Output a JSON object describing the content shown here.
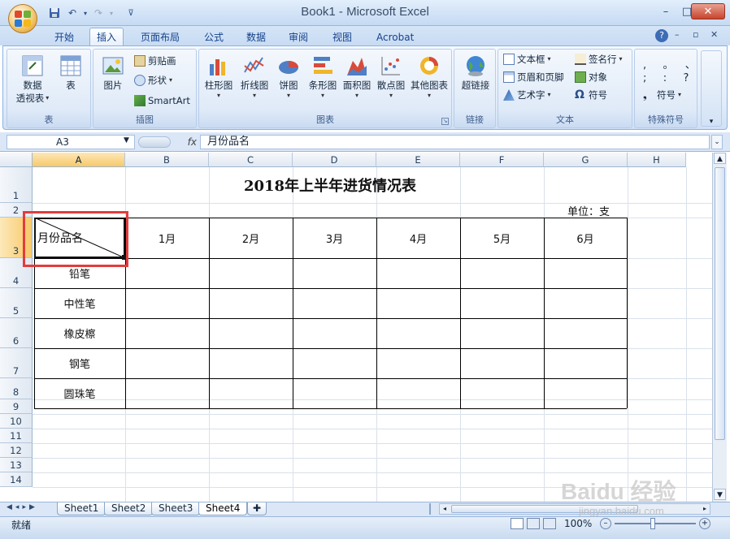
{
  "app": {
    "title": "Book1 - Microsoft Excel"
  },
  "window_controls": {
    "minimize": "–",
    "maximize": "□",
    "close": "✕"
  },
  "ribbon_tabs": [
    "开始",
    "插入",
    "页面布局",
    "公式",
    "数据",
    "审阅",
    "视图",
    "Acrobat"
  ],
  "active_tab": "插入",
  "ribbon": {
    "table_group": {
      "label": "表",
      "pivot": "数据\n透视表",
      "pivot_line1": "数据",
      "pivot_line2": "透视表",
      "table": "表"
    },
    "illust_group": {
      "label": "插图",
      "picture": "图片",
      "clipart": "剪贴画",
      "shapes": "形状",
      "smartart": "SmartArt"
    },
    "chart_group": {
      "label": "图表",
      "column": "柱形图",
      "line": "折线图",
      "pie": "饼图",
      "bar": "条形图",
      "area": "面积图",
      "scatter": "散点图",
      "other": "其他图表"
    },
    "link_group": {
      "label": "链接",
      "hyperlink": "超链接"
    },
    "text_group": {
      "label": "文本",
      "textbox": "文本框",
      "header_footer": "页眉和页脚",
      "wordart": "艺术字",
      "signature": "签名行",
      "object": "对象",
      "symbol": "符号"
    },
    "special_group": {
      "label": "特殊符号",
      "symbol": "符号",
      "chars_row1": ",   。  、",
      "chars_row2": ";   :   ?"
    }
  },
  "formula_bar": {
    "name_box": "A3",
    "fx": "fx",
    "value": "月份品名"
  },
  "columns": [
    "A",
    "B",
    "C",
    "D",
    "E",
    "F",
    "G",
    "H"
  ],
  "rows": [
    "1",
    "2",
    "3",
    "4",
    "5",
    "6",
    "7",
    "8",
    "9",
    "10",
    "11",
    "12",
    "13",
    "14"
  ],
  "sheet": {
    "title": "2018年上半年进货情况表",
    "unit": "单位：支",
    "corner_label": "月份品名",
    "months": [
      "1月",
      "2月",
      "3月",
      "4月",
      "5月",
      "6月"
    ],
    "items": [
      "铅笔",
      "中性笔",
      "橡皮檫",
      "钢笔",
      "圆珠笔"
    ]
  },
  "sheet_tabs": [
    "Sheet1",
    "Sheet2",
    "Sheet3",
    "Sheet4"
  ],
  "active_sheet": "Sheet4",
  "status": {
    "mode": "就绪",
    "zoom": "100%"
  },
  "watermark": {
    "brand": "Baidu 经验",
    "url": "jingyan.baidu.com"
  },
  "colors": {
    "selection_outline": "#e23c3c",
    "header_selected": "#f7c96a",
    "ribbon_border": "#8db2e3"
  }
}
